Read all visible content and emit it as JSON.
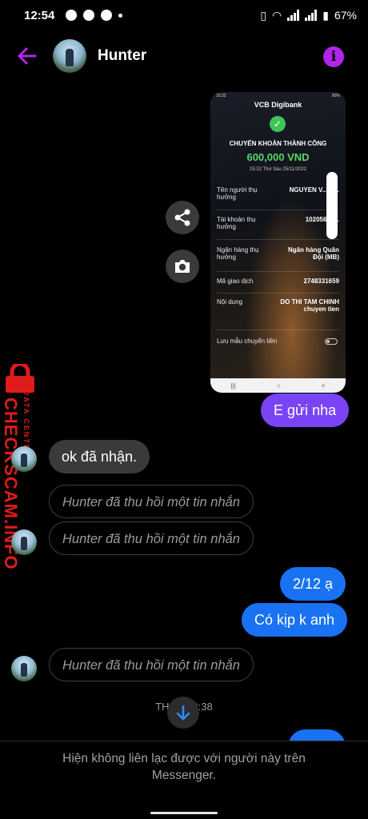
{
  "status_bar": {
    "time": "12:54",
    "battery": "67%"
  },
  "header": {
    "contact_name": "Hunter",
    "info_symbol": "i"
  },
  "receipt": {
    "status_time": "15:32",
    "status_battery": "80%",
    "bank": "VCB Digibank",
    "status": "CHUYỂN KHOẢN THÀNH CÔNG",
    "amount": "600,000 VND",
    "datetime": "15:32 Thứ Sáu 25/11/2022",
    "rows": [
      {
        "label": "Tên người thụ hưởng",
        "value": "NGUYEN V... B..."
      },
      {
        "label": "Tài khoản thụ hưởng",
        "value": "10205678..."
      },
      {
        "label": "Ngân hàng thụ hưởng",
        "value": "Ngân hàng Quân Đội (MB)"
      },
      {
        "label": "Mã giao dịch",
        "value": "2748331659"
      },
      {
        "label": "Nội dung",
        "value": "DO THI TAM CHINH chuyen tien"
      },
      {
        "label": "Lưu mẫu chuyển tiền",
        "value": ""
      }
    ],
    "nav": [
      "|||",
      "○",
      "<"
    ]
  },
  "messages": {
    "sent_1": "E gửi nha",
    "received_1": "ok đã nhận.",
    "unsent_1": "Hunter đã thu hồi một tin nhắn",
    "unsent_2": "Hunter đã thu hồi một tin nhắn",
    "sent_2": "2/12 ạ",
    "sent_3": "Có kịp k anh",
    "unsent_3": "Hunter đã thu hồi một tin nhắn"
  },
  "timestamp": "TH 5 ... 3:38",
  "watermark": {
    "main": "CHECKSCAM.INFO",
    "sub": "DATA CENTER"
  },
  "footer": {
    "notice": "Hiện không liên lạc được với người này trên Messenger."
  },
  "colors": {
    "sent_purple": "#7a44f5",
    "sent_blue": "#1872f2",
    "received_gray": "#3a3a3c",
    "info_purple": "#b026e8",
    "watermark_red": "#e01b1b",
    "success_green": "#59d66a"
  }
}
